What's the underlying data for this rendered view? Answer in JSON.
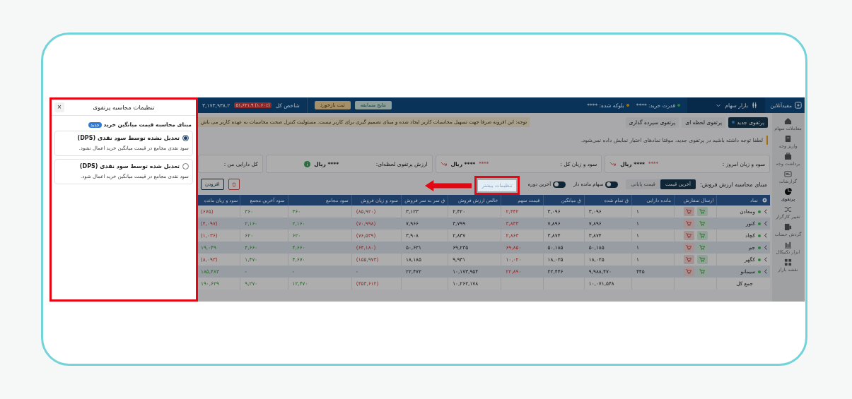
{
  "panel": {
    "close": "×",
    "title": "تنظیمات محاسبه پرتفوی",
    "section": "مبنای محاسبه قیمت میانگین خرید",
    "badge": "جدید",
    "options": [
      {
        "title": "تعدیل نشده توسط سود نقدی (DPS)",
        "description": "سود نقدی مجامع در قیمت میانگین خرید اعمال نشود.",
        "selected": true
      },
      {
        "title": "تعدیل شده توسط سود نقدی (DPS)",
        "description": "سود نقدی مجامع در قیمت میانگین خرید اعمال شود.",
        "selected": false
      }
    ]
  },
  "topbar": {
    "brand": "مفید‌آنلاین",
    "market": "بازار سهام",
    "buying_power": "قدرت خرید: ****",
    "blocked": "بلوکه شده: ****",
    "buttons": [
      "نتایج مسابقه",
      "ثبت بازخورد"
    ],
    "index_label": "شاخص کل",
    "index_change": "(۱.۶۰٪) ۵۱,۶۲۱.۹",
    "index_value": "۳,۱۷۳,۹۳۸.۲"
  },
  "sidebar": [
    {
      "label": "معاملات سهام",
      "selected": false
    },
    {
      "label": "واریز وجه",
      "selected": false
    },
    {
      "label": "برداشت وجه",
      "selected": false
    },
    {
      "label": "گزارشات",
      "selected": false
    },
    {
      "label": "پرتفوی",
      "selected": true
    },
    {
      "label": "تغییر کارگزار",
      "selected": false
    },
    {
      "label": "گردش حساب",
      "selected": false
    },
    {
      "label": "ابزار تکنیکال",
      "selected": false
    },
    {
      "label": "نقشه بازار",
      "selected": false
    }
  ],
  "tabs": [
    {
      "label": "پرتفوی جدید",
      "selected": true
    },
    {
      "label": "پرتفوی لحظه ای",
      "selected": false
    },
    {
      "label": "پرتفوی سپرده گذاری",
      "selected": false
    }
  ],
  "notice": "توجه: این افزونه صرفا جهت تسهیل محاسبات کاربر ایجاد شده و مبنای تصمیم گیری برای کاربر نیست. مسئولیت کنترل صحت محاسبات به عهده کاربر می باش",
  "info": "لطفا توجه داشته باشید در پرتفوی جدید، موقتا نمادهای اختیار نمایش داده نمی‌شود.",
  "cards": [
    {
      "label": "سود و زیان امروز :",
      "change": "****",
      "value": "**** ریال",
      "falling": true
    },
    {
      "label": "سود و زیان کل :",
      "change": "****",
      "value": "**** ریال",
      "falling": true
    },
    {
      "label": "ارزش پرتفوی لحظه‌ای:",
      "value": "**** ریال",
      "info": true
    },
    {
      "label": "کل دارایی من :"
    }
  ],
  "controls": {
    "label": "مبنای محاسبه ارزش فروش:",
    "price_options": [
      {
        "label": "آخرین قیمت",
        "selected": true
      },
      {
        "label": "قیمت پایانی",
        "selected": false
      }
    ],
    "toggles": [
      {
        "label": "سهام مانده دار",
        "on": false
      },
      {
        "label": "آخرین دوره",
        "on": false
      }
    ],
    "more_settings": "تنظیمات بیشتر",
    "add": "افزودن"
  },
  "table": {
    "columns": [
      {
        "label": "نماد",
        "kind": "symbol"
      },
      {
        "label": "ارسال سفارش",
        "kind": "order"
      },
      {
        "label": "مانده دارایی",
        "kind": "plain"
      },
      {
        "label": "ق تمام شده",
        "kind": "plain"
      },
      {
        "label": "ق میانگین",
        "kind": "plain"
      },
      {
        "label": "قیمت سهم",
        "kind": "loss"
      },
      {
        "label": "خالص ارزش فروش",
        "kind": "plain"
      },
      {
        "label": "ق سر به سر فروش",
        "kind": "plain"
      },
      {
        "label": "سود و زیان فروش",
        "kind": "loss"
      },
      {
        "label": "سود مجامع",
        "kind": "gain"
      },
      {
        "label": "سود آخرین مجمع",
        "kind": "gain"
      },
      {
        "label": "سود و زیان مانده",
        "kind": "signed"
      }
    ],
    "rows": [
      {
        "kind": "stock",
        "loss": true,
        "cells": [
          "ومعادن",
          "",
          "۱",
          "۳,۰۹۶",
          "۳,۰۹۶",
          "۲,۴۴۲",
          "۲,۴۲۰",
          "۳,۱۲۳",
          "(۸۵,۹۲۰)",
          "۳۶۰",
          "۳۶۰",
          "(۶۷۵)"
        ]
      },
      {
        "kind": "stock",
        "loss": true,
        "cells": [
          "کنور",
          "",
          "۱",
          "۷,۸۹۶",
          "۷,۸۹۶",
          "۳,۸۳۳",
          "۳,۷۹۹",
          "۷,۹۶۶",
          "(۷۰,۹۹۸)",
          "۲,۱۶۰",
          "۲,۱۶۰",
          "(۴,۰۹۷)"
        ]
      },
      {
        "kind": "stock",
        "loss": true,
        "cells": [
          "کچاد",
          "",
          "۱",
          "۳,۸۷۴",
          "۳,۸۷۴",
          "۲,۸۶۳",
          "۲,۸۳۷",
          "۳,۹۰۸",
          "(۷۶,۵۳۹)",
          "۶۲۰",
          "۶۲۰",
          "(۱,۰۳۶)"
        ]
      },
      {
        "kind": "stock",
        "loss": false,
        "cells": [
          "جم",
          "",
          "۱",
          "۵۰,۱۸۵",
          "۵۰,۱۸۵",
          "۶۹,۸۵۰",
          "۶۹,۲۳۵",
          "۵۰,۶۳۱",
          "(۶۴,۱۸۰)",
          "۴,۶۶۰",
          "۴,۶۶۰",
          "۱۹,۰۴۹"
        ]
      },
      {
        "kind": "stock",
        "loss": true,
        "cells": [
          "کگهر",
          "",
          "۱",
          "۱۸,۰۲۵",
          "۱۸,۰۲۵",
          "۱۰,۰۲۰",
          "۹,۹۳۱",
          "۱۸,۱۸۵",
          "(۱۵۵,۹۷۳)",
          "۴,۶۷۰",
          "۱,۴۷۰",
          "(۸,۰۹۳)"
        ]
      },
      {
        "kind": "stock",
        "loss": false,
        "cells": [
          "سیمانو",
          "",
          "۴۴۵",
          "۹,۹۸۸,۴۷۰",
          "۲۲,۴۴۶",
          "۲۲,۸۹۰",
          "۱۰,۱۷۳,۹۵۴",
          "۲۲,۴۷۲",
          "-",
          "-",
          "-",
          "۱۸۵,۴۸۳"
        ]
      },
      {
        "kind": "total",
        "loss": false,
        "cells": [
          "جمع کل",
          "",
          "",
          "۱۰,۰۷۱,۵۴۸",
          "",
          "",
          "۱۰,۲۶۲,۱۷۸",
          "",
          "(۴۵۳,۶۱۲)",
          "۱۲,۴۷۰",
          "۹,۲۷۰",
          "۱۹۰,۶۲۹"
        ]
      }
    ]
  }
}
